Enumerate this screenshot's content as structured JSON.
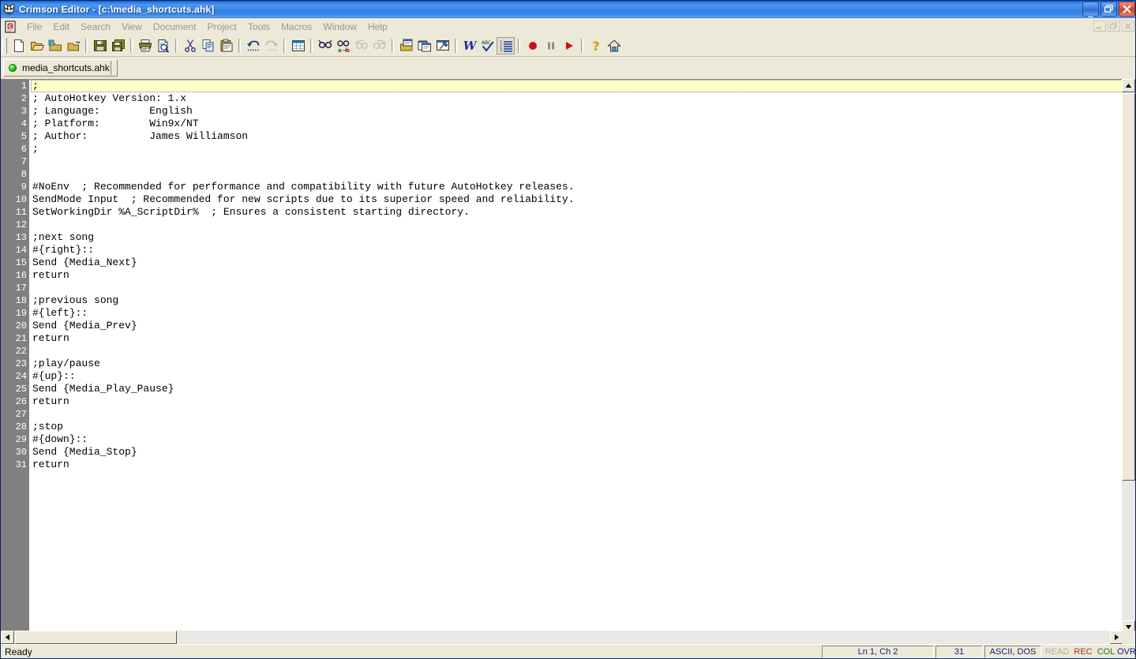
{
  "window": {
    "title": "Crimson Editor - [c:\\media_shortcuts.ahk]",
    "app_icon": "crimson-editor-icon",
    "buttons": {
      "minimize": "_",
      "maximize": "❐",
      "close": "✕"
    },
    "mdi_buttons": {
      "minimize": "_",
      "restore": "❐",
      "close": "✕"
    }
  },
  "menu": {
    "doc_icon": "document-icon",
    "items": [
      "File",
      "Edit",
      "Search",
      "View",
      "Document",
      "Project",
      "Tools",
      "Macros",
      "Window",
      "Help"
    ]
  },
  "toolbar": {
    "groups": [
      [
        "new-file-icon",
        "open-file-icon",
        "open-project-icon",
        "close-file-icon"
      ],
      [
        "save-icon",
        "save-all-icon"
      ],
      [
        "print-icon",
        "print-preview-icon"
      ],
      [
        "cut-icon",
        "copy-icon",
        "paste-icon"
      ],
      [
        "undo-icon",
        "redo-icon"
      ],
      [
        "column-mode-icon"
      ],
      [
        "find-icon",
        "find-replace-icon",
        "find-previous-icon",
        "find-next-icon"
      ],
      [
        "open-window-icon",
        "copy-window-icon",
        "execute-icon"
      ],
      [
        "word-wrap-icon",
        "spell-check-icon",
        "line-numbers-icon"
      ],
      [
        "record-macro-icon",
        "pause-macro-icon",
        "play-macro-icon"
      ],
      [
        "help-icon",
        "home-icon"
      ]
    ]
  },
  "tab": {
    "status_icon": "saved-dot-icon",
    "label": "media_shortcuts.ahk"
  },
  "editor": {
    "current_line": 1,
    "lines": [
      {
        "n": "1",
        "text": ";"
      },
      {
        "n": "2",
        "text": "; AutoHotkey Version: 1.x"
      },
      {
        "n": "3",
        "text": "; Language:        English"
      },
      {
        "n": "4",
        "text": "; Platform:        Win9x/NT"
      },
      {
        "n": "5",
        "text": "; Author:          James Williamson"
      },
      {
        "n": "6",
        "text": ";"
      },
      {
        "n": "7",
        "text": ""
      },
      {
        "n": "8",
        "text": ""
      },
      {
        "n": "9",
        "text": "#NoEnv  ; Recommended for performance and compatibility with future AutoHotkey releases."
      },
      {
        "n": "10",
        "text": "SendMode Input  ; Recommended for new scripts due to its superior speed and reliability."
      },
      {
        "n": "11",
        "text": "SetWorkingDir %A_ScriptDir%  ; Ensures a consistent starting directory."
      },
      {
        "n": "12",
        "text": ""
      },
      {
        "n": "13",
        "text": ";next song"
      },
      {
        "n": "14",
        "text": "#{right}::"
      },
      {
        "n": "15",
        "text": "Send {Media_Next}"
      },
      {
        "n": "16",
        "text": "return"
      },
      {
        "n": "17",
        "text": ""
      },
      {
        "n": "18",
        "text": ";previous song"
      },
      {
        "n": "19",
        "text": "#{left}::"
      },
      {
        "n": "20",
        "text": "Send {Media_Prev}"
      },
      {
        "n": "21",
        "text": "return"
      },
      {
        "n": "22",
        "text": ""
      },
      {
        "n": "23",
        "text": ";play/pause"
      },
      {
        "n": "24",
        "text": "#{up}::"
      },
      {
        "n": "25",
        "text": "Send {Media_Play_Pause}"
      },
      {
        "n": "26",
        "text": "return"
      },
      {
        "n": "27",
        "text": ""
      },
      {
        "n": "28",
        "text": ";stop"
      },
      {
        "n": "29",
        "text": "#{down}::"
      },
      {
        "n": "30",
        "text": "Send {Media_Stop}"
      },
      {
        "n": "31",
        "text": "return"
      }
    ]
  },
  "scrollbars": {
    "vertical_up": "▲",
    "vertical_down": "▼",
    "horizontal_left": "◀",
    "horizontal_right": "▶"
  },
  "statusbar": {
    "ready": "Ready",
    "position": "Ln 1, Ch 2",
    "total_lines": "31",
    "encoding": "ASCII, DOS",
    "flags": [
      {
        "label": "READ",
        "color": "#b0ada0"
      },
      {
        "label": "REC",
        "color": "#a93226"
      },
      {
        "label": "COL",
        "color": "#1e7a1e"
      },
      {
        "label": "OVR",
        "color": "#1b1b7a"
      }
    ]
  },
  "colors": {
    "titlebar_blue": "#3f8ae8",
    "chrome": "#ece9d8",
    "gutter": "#808080",
    "editor_bg": "#ffffff",
    "current_line": "#ffffcc"
  }
}
